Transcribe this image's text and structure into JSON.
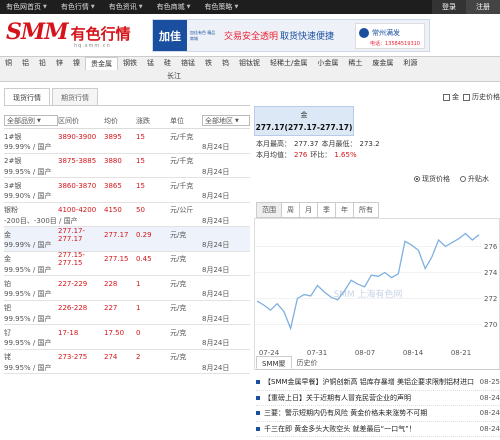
{
  "topbar": {
    "nav": [
      {
        "label": "有色网首页"
      },
      {
        "label": "有色行情"
      },
      {
        "label": "有色资讯"
      },
      {
        "label": "有色商城"
      },
      {
        "label": "有色策略"
      }
    ],
    "login": "登录",
    "register": "注册"
  },
  "header": {
    "logo_smm": "SMM",
    "logo_cn": "有色行情",
    "logo_url": "hq.smm.cn",
    "banner": {
      "brand": "加佳",
      "brand_sub": "加佳有色 精品商城",
      "slogan_red": "交易安全透明",
      "slogan_blue": "取货快速便捷",
      "store_name": "常州满发",
      "store_phone": "电话：13584519310"
    }
  },
  "categories": {
    "row1": [
      "铜",
      "铝",
      "铅",
      "锌",
      "镍",
      "贵金属",
      "钢铁",
      "锰",
      "硅",
      "铬锰",
      "铁",
      "钨",
      "钼钛铌",
      "轻稀土/金属",
      "小金属",
      "稀土",
      "废金属",
      "利源"
    ],
    "row2": [
      "长江"
    ],
    "active": "贵金属"
  },
  "left": {
    "tabs": [
      "现货行情",
      "期货行情"
    ],
    "headers": {
      "name_select": "全部品别",
      "range": "区间价",
      "avg": "均价",
      "change": "涨跌",
      "unit": "单位",
      "region_select": "全部地区"
    },
    "rows": [
      {
        "name": "1#银",
        "spec": "99.99% / 国产",
        "range": "3890-3900",
        "avg": "3895",
        "chg": "15",
        "unit": "元/千克",
        "date": "8月24日",
        "hl": false
      },
      {
        "name": "2#银",
        "spec": "99.95% / 国产",
        "range": "3875-3885",
        "avg": "3880",
        "chg": "15",
        "unit": "元/千克",
        "date": "8月24日",
        "hl": false
      },
      {
        "name": "3#银",
        "spec": "99.90% / 国产",
        "range": "3860-3870",
        "avg": "3865",
        "chg": "15",
        "unit": "元/千克",
        "date": "8月24日",
        "hl": false
      },
      {
        "name": "银粉",
        "spec": "-200目、-300目 / 国产",
        "range": "4100-4200",
        "avg": "4150",
        "chg": "50",
        "unit": "元/公斤",
        "date": "8月24日",
        "hl": false
      },
      {
        "name": "金",
        "spec": "99.99% / 国产",
        "range": "277.17-277.17",
        "avg": "277.17",
        "chg": "0.29",
        "unit": "元/克",
        "date": "8月24日",
        "hl": true
      },
      {
        "name": "金",
        "spec": "99.95% / 国产",
        "range": "277.15-277.15",
        "avg": "277.15",
        "chg": "0.45",
        "unit": "元/克",
        "date": "8月24日",
        "hl": false
      },
      {
        "name": "铂",
        "spec": "99.95% / 国产",
        "range": "227-229",
        "avg": "228",
        "chg": "1",
        "unit": "元/克",
        "date": "8月24日",
        "hl": false
      },
      {
        "name": "钯",
        "spec": "99.95% / 国产",
        "range": "226-228",
        "avg": "227",
        "chg": "1",
        "unit": "元/克",
        "date": "8月24日",
        "hl": false
      },
      {
        "name": "钌",
        "spec": "99.95% / 国产",
        "range": "17-18",
        "avg": "17.50",
        "chg": "0",
        "unit": "元/克",
        "date": "8月24日",
        "hl": false
      },
      {
        "name": "铑",
        "spec": "99.95% / 国产",
        "range": "273-275",
        "avg": "274",
        "chg": "2",
        "unit": "元/克",
        "date": "8月24日",
        "hl": false
      }
    ]
  },
  "right": {
    "tools": {
      "share": "金",
      "history": "历史价格"
    },
    "quote": {
      "name": "金",
      "value": "277.17(277.17-277.17)"
    },
    "stats": {
      "month_high_label": "本月最高：",
      "month_high": "277.37",
      "month_low_label": "本月最低：",
      "month_low": "273.2",
      "month_avg_label": "本月均值：",
      "month_avg": "276",
      "ring_label": "环比：",
      "ring": "1.65%"
    },
    "toggles": {
      "spot": "现货价格",
      "futures": "升贴水"
    },
    "ranges": [
      "范围",
      "周",
      "月",
      "季",
      "年",
      "所有"
    ],
    "news_tabs": [
      "SMM聚",
      "历史价"
    ],
    "news": [
      {
        "title": "【SMM金属早餐】沪铜创新高 铝库存暴增 美铝企要求限制铝材进口",
        "date": "08-25"
      },
      {
        "title": "【重磅上日】关于近期有人冒充民营企业的声明",
        "date": "08-24"
      },
      {
        "title": "三要：警示短期内仍有风险 黄金价格未来涨势不可期",
        "date": "08-24"
      },
      {
        "title": "千三在即 黄金多头大败空头 就差最后“一口气”！",
        "date": "08-24"
      }
    ]
  },
  "chart_data": {
    "type": "line",
    "x_ticks": [
      "07-24",
      "07-31",
      "08-07",
      "08-14",
      "08-21"
    ],
    "y_ticks": [
      276,
      274,
      272,
      270
    ],
    "ylim": [
      269.5,
      277.5
    ],
    "watermark": "SMM 上海有色网",
    "series": [
      {
        "values": [
          271.8,
          271.5,
          271.1,
          271.6,
          271.0,
          269.7,
          272.0,
          272.3,
          272.2,
          273.0,
          272.5,
          272.1,
          271.9,
          272.6,
          273.4,
          273.1,
          272.9,
          273.8,
          273.7,
          274.0,
          273.6,
          273.9,
          276.4,
          276.1,
          275.7,
          274.3,
          275.2,
          276.5,
          276.0,
          276.3,
          276.6,
          277.0,
          276.5,
          276.9
        ]
      }
    ]
  }
}
